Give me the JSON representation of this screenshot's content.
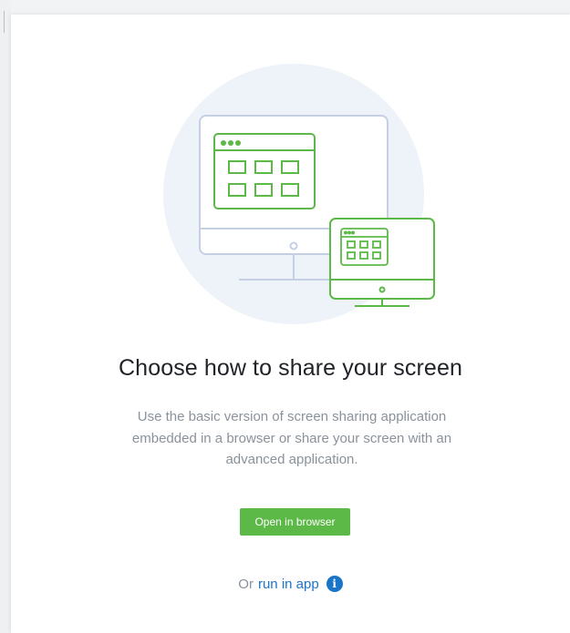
{
  "content": {
    "title": "Choose how to share your screen",
    "description": "Use the basic version of screen sharing application embedded in a browser or share your screen with an advanced application.",
    "open_button_label": "Open in browser",
    "or_text": "Or",
    "run_link_label": "run in app",
    "info_icon_glyph": "i"
  },
  "colors": {
    "accent_green": "#5cb948",
    "link_blue": "#1a74c7",
    "monitor_outline": "#c5d0e4",
    "circle_bg": "#eef3fa"
  },
  "icons": {
    "illustration": "screen-share-illustration",
    "info": "info-icon"
  }
}
